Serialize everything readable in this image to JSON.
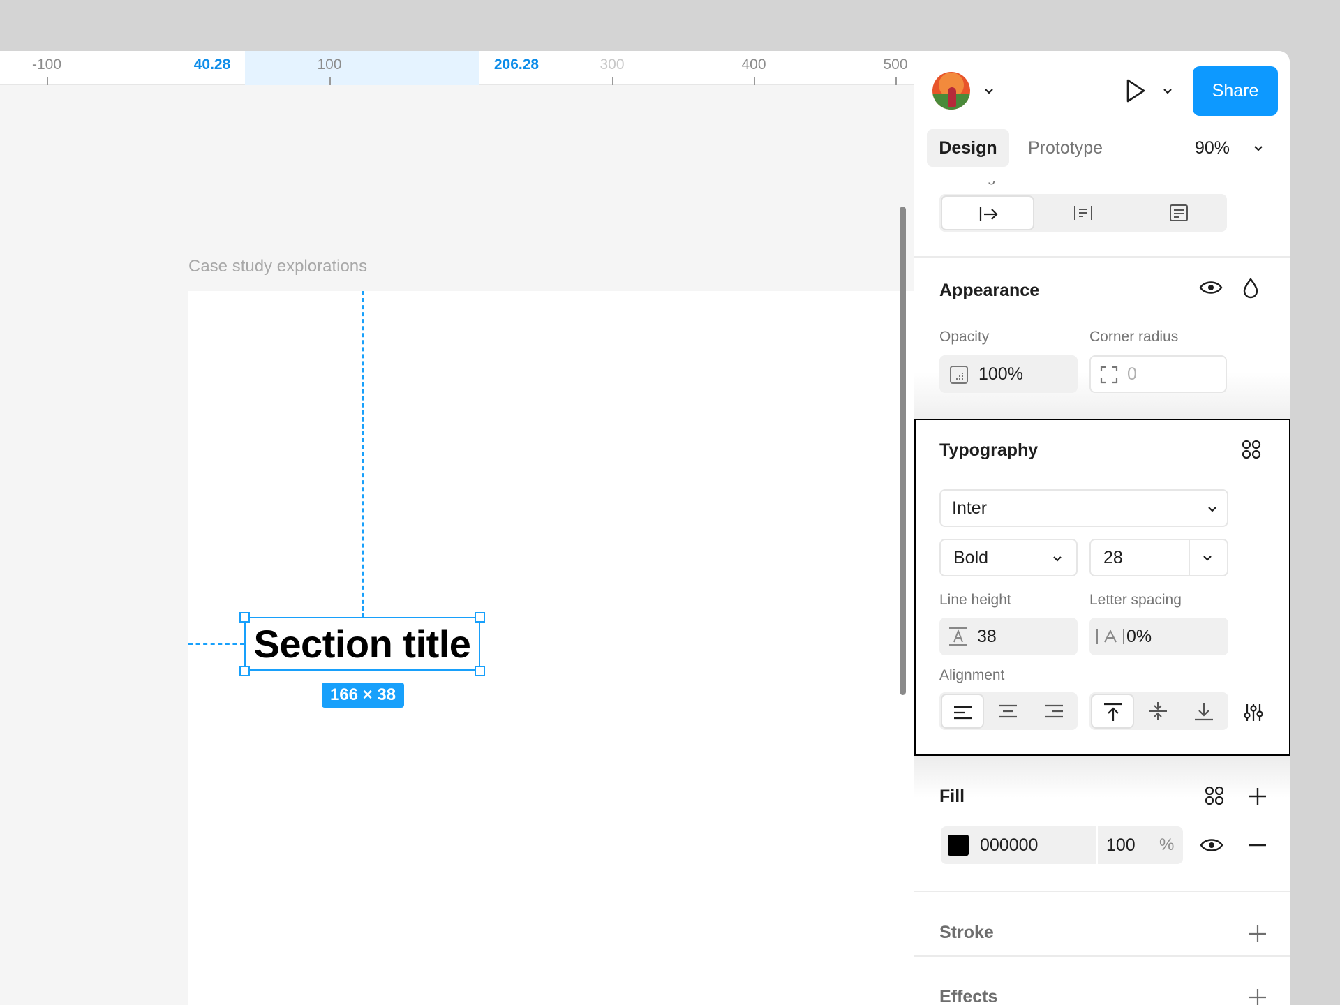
{
  "ruler": {
    "ticks": [
      "-100",
      "40.28",
      "100",
      "206.28",
      "300",
      "400",
      "500"
    ]
  },
  "canvas": {
    "frame_label": "Case study explorations",
    "text_layer": "Section title",
    "size_badge": "166 × 38"
  },
  "header": {
    "share_label": "Share",
    "tabs": [
      "Design",
      "Prototype"
    ],
    "zoom": "90%"
  },
  "resizing": {
    "label": "Resizing"
  },
  "appearance": {
    "title": "Appearance",
    "opacity_label": "Opacity",
    "opacity_value": "100%",
    "corner_label": "Corner radius",
    "corner_value": "0"
  },
  "typography": {
    "title": "Typography",
    "font_family": "Inter",
    "font_weight": "Bold",
    "font_size": "28",
    "line_height_label": "Line height",
    "line_height_value": "38",
    "letter_spacing_label": "Letter spacing",
    "letter_spacing_value": "0%",
    "alignment_label": "Alignment"
  },
  "fill": {
    "title": "Fill",
    "hex": "000000",
    "opacity": "100",
    "percent": "%",
    "color": "#000000"
  },
  "stroke": {
    "title": "Stroke"
  },
  "effects": {
    "title": "Effects"
  },
  "colors": {
    "accent": "#18a0fb",
    "share": "#0d99ff",
    "ruler_highlight": "#e5f3ff"
  }
}
